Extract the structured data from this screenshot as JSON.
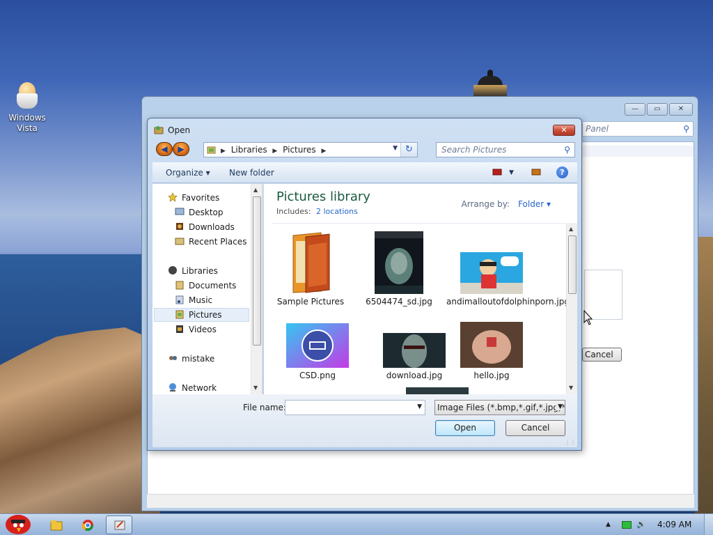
{
  "desktop": {
    "icon_label": "Windows Vista"
  },
  "background_window": {
    "search_placeholder": "Panel",
    "cancel_label": "Cancel",
    "minimize": "—",
    "maximize": "▭",
    "close": "✕"
  },
  "dialog": {
    "title": "Open",
    "close": "✕",
    "address": {
      "crumbs": [
        "Libraries",
        "Pictures"
      ]
    },
    "search_placeholder": "Search Pictures",
    "toolbar": {
      "organize": "Organize ▾",
      "new_folder": "New folder",
      "help": "?"
    },
    "nav": {
      "favorites": "Favorites",
      "desktop": "Desktop",
      "downloads": "Downloads",
      "recent_places": "Recent Places",
      "libraries": "Libraries",
      "documents": "Documents",
      "music": "Music",
      "pictures": "Pictures",
      "videos": "Videos",
      "homegroup": "mistake",
      "network": "Network"
    },
    "library": {
      "title": "Pictures library",
      "includes_label": "Includes:",
      "includes_link": "2 locations",
      "arrange_label": "Arrange by:",
      "arrange_value": "Folder ▾"
    },
    "items": [
      {
        "name": "Sample Pictures"
      },
      {
        "name": "6504474_sd.jpg"
      },
      {
        "name": "andimalloutofdolphinporn.jpg"
      },
      {
        "name": "CSD.png"
      },
      {
        "name": "download.jpg"
      },
      {
        "name": "hello.jpg"
      }
    ],
    "file_name_label": "File name:",
    "file_name_value": "",
    "filter_value": "Image Files (*.bmp,*.gif,*.jpg,*.",
    "open_label": "Open",
    "cancel_label": "Cancel"
  },
  "taskbar": {
    "clock": "4:09 AM"
  },
  "colors": {
    "accent_blue": "#2766c9",
    "library_title": "#1a5a40",
    "close_red": "#c84a35"
  }
}
